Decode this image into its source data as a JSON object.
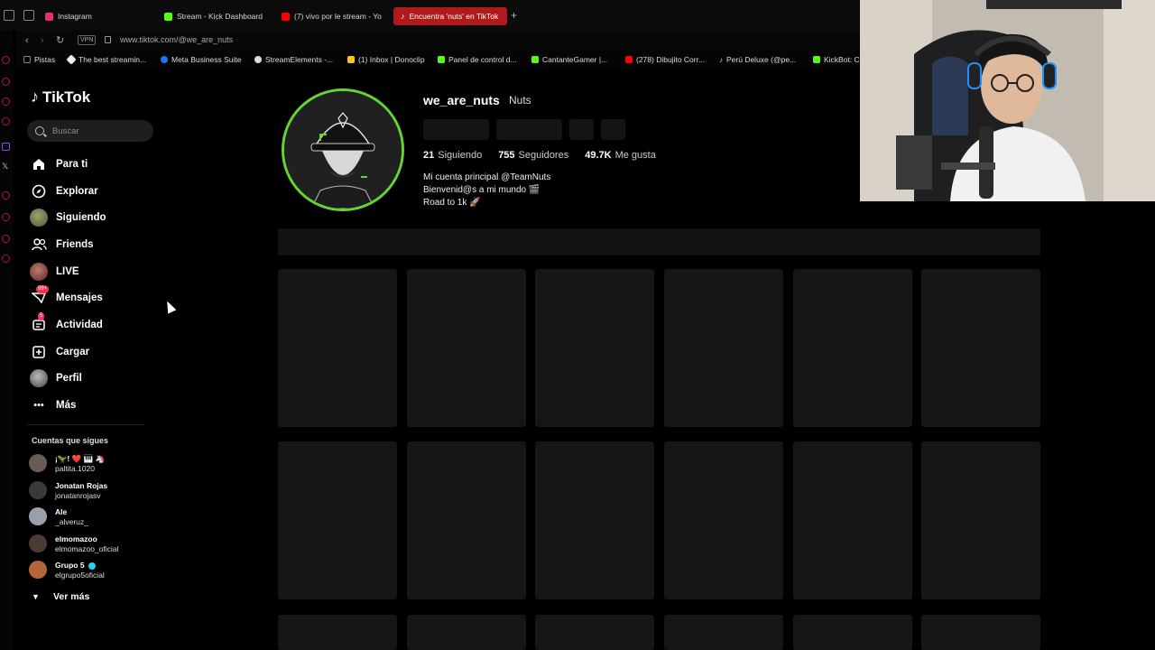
{
  "browser": {
    "tabs": [
      {
        "label": "Instagram",
        "color": "#e1306c",
        "active": false
      },
      {
        "label": "Stream - Kick Dashboard",
        "color": "#53fc18",
        "active": false
      },
      {
        "label": "(7) vivo por le stream - Yo",
        "color": "#ff0000",
        "active": false
      },
      {
        "label": "Encuentra 'nuts' en TikTok",
        "color": "#ffffff",
        "active": true
      }
    ],
    "new_tab": "+",
    "vpn_label": "VPN",
    "url": "www.tiktok.com/@we_are_nuts",
    "bookmarks": [
      {
        "label": "Pistas",
        "color": "#888888"
      },
      {
        "label": "The best streamin...",
        "color": "#eeeeee"
      },
      {
        "label": "Meta Business Suite",
        "color": "#1877f2"
      },
      {
        "label": "StreamElements -...",
        "color": "#dddddd"
      },
      {
        "label": "(1) Inbox | Donoclip",
        "color": "#f5c518"
      },
      {
        "label": "Panel de control d...",
        "color": "#53fc18"
      },
      {
        "label": "CantanteGamer |...",
        "color": "#53fc18"
      },
      {
        "label": "(278) Dibujito Corr...",
        "color": "#ff0000"
      },
      {
        "label": "Perú Deluxe (@pe...",
        "color": "#ffffff"
      },
      {
        "label": "KickBot: C",
        "color": "#53fc18"
      }
    ]
  },
  "sidebar": {
    "logo": "TikTok",
    "search_placeholder": "Buscar",
    "nav": [
      {
        "label": "Para ti",
        "icon": "home-icon"
      },
      {
        "label": "Explorar",
        "icon": "compass-icon"
      },
      {
        "label": "Siguiendo",
        "icon": "following-avatar-icon"
      },
      {
        "label": "Friends",
        "icon": "friends-icon"
      },
      {
        "label": "LIVE",
        "icon": "live-avatar-icon"
      },
      {
        "label": "Mensajes",
        "icon": "messages-icon",
        "badge": "99+"
      },
      {
        "label": "Actividad",
        "icon": "activity-icon",
        "badge": "5"
      },
      {
        "label": "Cargar",
        "icon": "upload-icon"
      },
      {
        "label": "Perfil",
        "icon": "profile-avatar-icon"
      },
      {
        "label": "Más",
        "icon": "more-icon"
      }
    ],
    "following_title": "Cuentas que sigues",
    "following": [
      {
        "name": "¡🦖! ❤️ 🎹 🦄",
        "handle": "paltita.1020",
        "color": "#6a5a58"
      },
      {
        "name": "Jonatan Rojas",
        "handle": "jonatanrojasv",
        "color": "#3a3a3a"
      },
      {
        "name": "Ale",
        "handle": "_alveruz_",
        "color": "#9aa0aa"
      },
      {
        "name": "elmomazoo",
        "handle": "elmomazoo_oficial",
        "color": "#4b3b36"
      },
      {
        "name": "Grupo 5",
        "handle": "elgrupo5oficial",
        "color": "#b3663a"
      }
    ],
    "see_more": "Ver más"
  },
  "profile": {
    "username": "we_are_nuts",
    "nickname": "Nuts",
    "stats": [
      {
        "value": "21",
        "label": "Siguiendo"
      },
      {
        "value": "755",
        "label": "Seguidores"
      },
      {
        "value": "49.7K",
        "label": "Me gusta"
      }
    ],
    "bio": [
      "Mi cuenta principal @TeamNuts",
      "Bienvenid@s a mi mundo 🎬",
      "Road to 1k 🚀"
    ],
    "accent": "#64d435"
  }
}
